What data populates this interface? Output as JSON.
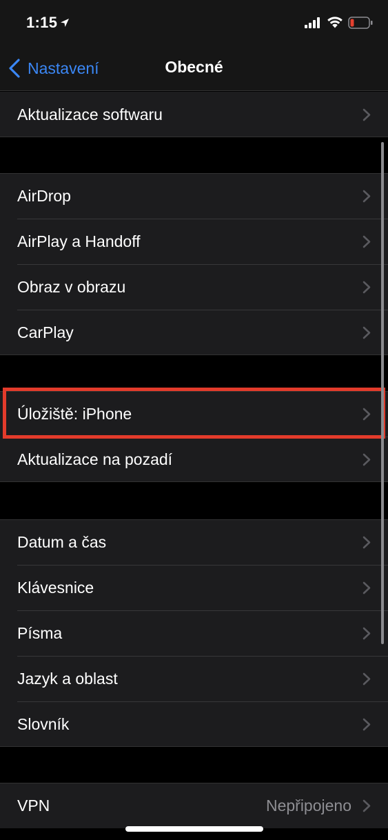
{
  "status_bar": {
    "time": "1:15",
    "icons": [
      "location-arrow-icon",
      "cellular-signal-icon",
      "wifi-icon",
      "battery-low-icon"
    ],
    "battery_color": "#e5412f"
  },
  "nav": {
    "back_label": "Nastavení",
    "title": "Obecné"
  },
  "colors": {
    "accent": "#3b87f5",
    "highlight": "#e33b2b",
    "background": "#000000",
    "cell": "#1c1c1e"
  },
  "groups": [
    {
      "items": [
        {
          "label": "Aktualizace softwaru"
        }
      ]
    },
    {
      "items": [
        {
          "label": "AirDrop"
        },
        {
          "label": "AirPlay a Handoff"
        },
        {
          "label": "Obraz v obrazu"
        },
        {
          "label": "CarPlay"
        }
      ]
    },
    {
      "items": [
        {
          "label": "Úložiště: iPhone",
          "highlighted": true
        },
        {
          "label": "Aktualizace na pozadí"
        }
      ]
    },
    {
      "items": [
        {
          "label": "Datum a čas"
        },
        {
          "label": "Klávesnice"
        },
        {
          "label": "Písma"
        },
        {
          "label": "Jazyk a oblast"
        },
        {
          "label": "Slovník"
        }
      ]
    },
    {
      "items": [
        {
          "label": "VPN",
          "value": "Nepřipojeno"
        }
      ]
    }
  ]
}
